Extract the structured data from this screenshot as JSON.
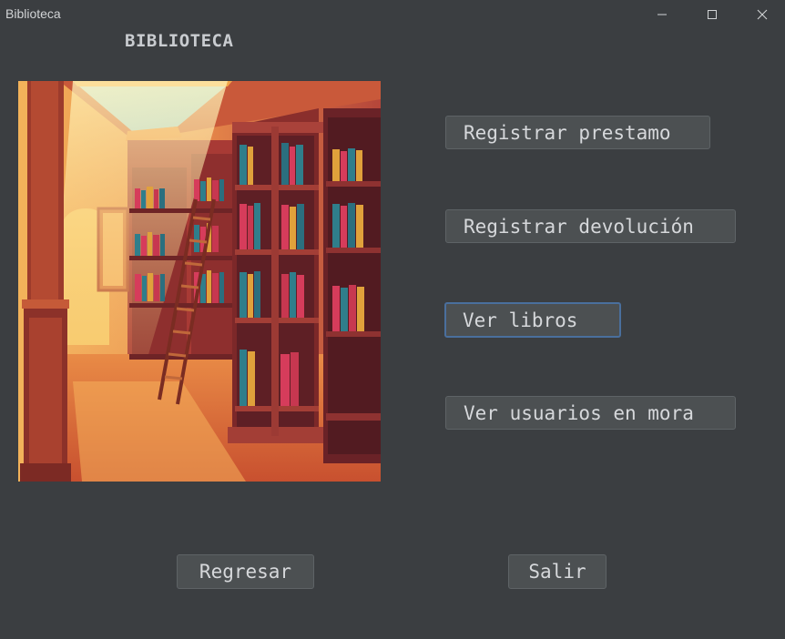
{
  "window": {
    "title": "Biblioteca"
  },
  "heading": "BIBLIOTECA",
  "image": {
    "subject": "library-illustration"
  },
  "actions": {
    "registrar_prestamo": "Registrar prestamo",
    "registrar_devolucion": "Registrar devolución",
    "ver_libros": "Ver libros",
    "ver_usuarios_mora": "Ver usuarios en mora"
  },
  "footer": {
    "regresar": "Regresar",
    "salir": "Salir"
  },
  "colors": {
    "background": "#3b3e41",
    "button": "#4c5052",
    "button_border": "#5e6366",
    "focus_border": "#4a6f9d",
    "text": "#d6d8db"
  }
}
